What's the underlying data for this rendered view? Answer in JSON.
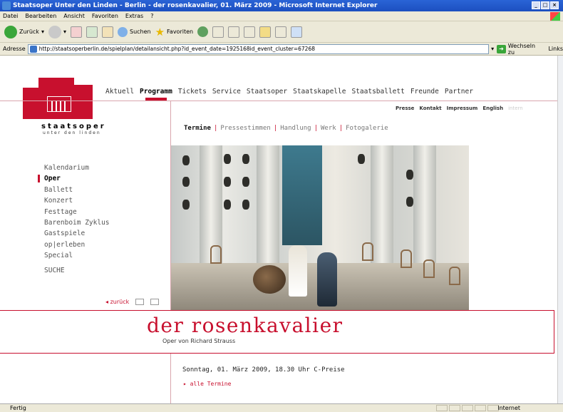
{
  "browser": {
    "title": "Staatsoper Unter den Linden - Berlin - der rosenkavalier, 01. März 2009 - Microsoft Internet Explorer",
    "menu": [
      "Datei",
      "Bearbeiten",
      "Ansicht",
      "Favoriten",
      "Extras",
      "?"
    ],
    "toolbar": {
      "back": "Zurück",
      "search": "Suchen",
      "favorites": "Favoriten"
    },
    "address_label": "Adresse",
    "url": "http://staatsoperberlin.de/spielplan/detailansicht.php?id_event_date=1925168id_event_cluster=67268",
    "go": "Wechseln zu",
    "links": "Links",
    "status": "Fertig",
    "zone": "Internet"
  },
  "site": {
    "wordmark": "staatsoper",
    "wordmark_sub": "unter den linden",
    "topnav": [
      "Aktuell",
      "Programm",
      "Tickets",
      "Service",
      "Staatsoper",
      "Staatskapelle",
      "Staatsballett",
      "Freunde",
      "Partner"
    ],
    "util": [
      "Presse",
      "Kontakt",
      "Impressum",
      "English",
      "intern"
    ],
    "subtabs": [
      "Termine",
      "Pressestimmen",
      "Handlung",
      "Werk",
      "Fotogalerie"
    ],
    "leftnav": [
      "Kalendarium",
      "Oper",
      "Ballett",
      "Konzert",
      "Festtage",
      "Barenboim Zyklus",
      "Gastspiele",
      "op|erleben",
      "Special"
    ],
    "search": "SUCHE",
    "back": "zurück",
    "opera_title": "der rosenkavalier",
    "opera_sub": "Oper von Richard Strauss",
    "date_line": "Sonntag, 01. März 2009, 18.30 Uhr  C-Preise",
    "all_dates": "alle Termine",
    "accent": "#c8102e"
  }
}
